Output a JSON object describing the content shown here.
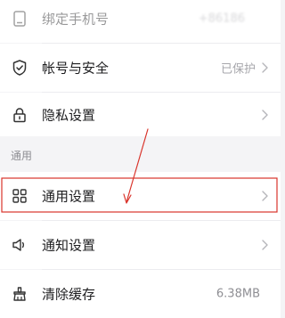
{
  "account": {
    "bind_phone": {
      "label": "绑定手机号",
      "value": "+86186",
      "icon": "phone-icon"
    },
    "security": {
      "label": "帐号与安全",
      "value": "已保护",
      "icon": "shield-check-icon"
    },
    "privacy": {
      "label": "隐私设置",
      "icon": "lock-icon"
    }
  },
  "general_section": {
    "title": "通用",
    "items": {
      "general_settings": {
        "label": "通用设置",
        "icon": "grid-icon"
      },
      "notification_settings": {
        "label": "通知设置",
        "icon": "speaker-icon"
      },
      "clear_cache": {
        "label": "清除缓存",
        "value": "6.38MB",
        "icon": "broom-icon"
      }
    }
  },
  "annotation": {
    "color": "#d9342b"
  }
}
